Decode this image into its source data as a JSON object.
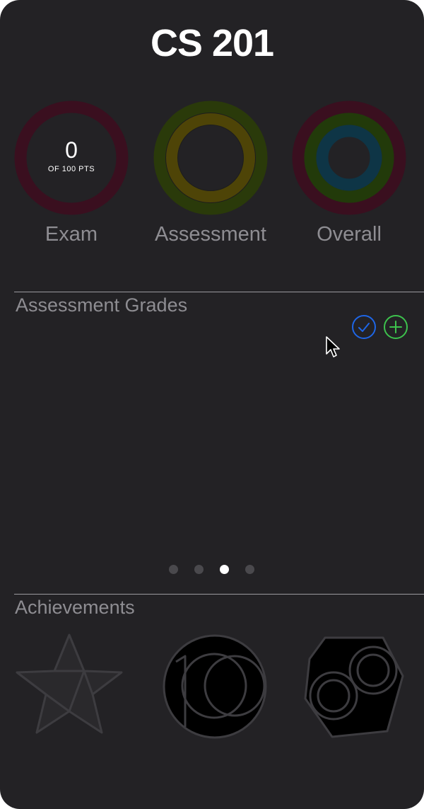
{
  "title": "CS 201",
  "rings": {
    "exam": {
      "label": "Exam",
      "value": "0",
      "sub": "OF 100 PTS"
    },
    "assessment": {
      "label": "Assessment"
    },
    "overall": {
      "label": "Overall"
    }
  },
  "colors": {
    "background": "#232225",
    "exam_ring": "#3a0f1f",
    "assessment_outer": "#2a3a0a",
    "assessment_inner": "#4e4407",
    "overall_mid": "#223a0a",
    "overall_inner": "#0e3546",
    "check_blue": "#1e66e6",
    "plus_green": "#3dc24d"
  },
  "assessment_grades": {
    "title": "Assessment Grades",
    "actions": {
      "check_icon": "checkmark-circle-icon",
      "add_icon": "plus-circle-icon"
    }
  },
  "pager": {
    "count": 4,
    "active_index": 2
  },
  "achievements": {
    "title": "Achievements",
    "badges": [
      "star-badge-icon",
      "hundred-badge-icon",
      "rings-badge-icon"
    ]
  }
}
